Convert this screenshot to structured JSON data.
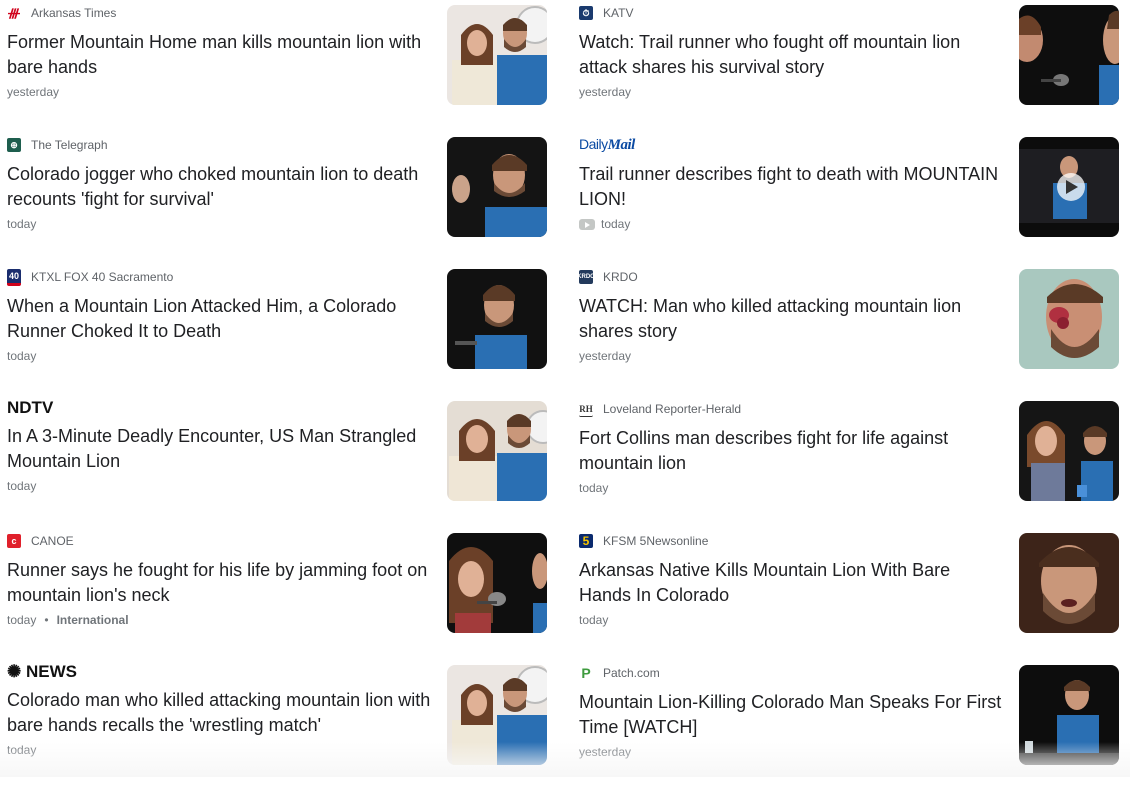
{
  "articles": [
    {
      "source": "Arkansas Times",
      "headline": "Former Mountain Home man kills mountain lion with bare hands",
      "time": "yesterday",
      "logo": "arkansas-times-logo",
      "thumb": "couple-photo-thumbnail"
    },
    {
      "source": "KATV",
      "headline": "Watch: Trail runner who fought off mountain lion attack shares his survival story",
      "time": "yesterday",
      "logo": "katv-logo",
      "thumb": "man-at-microphone-thumbnail"
    },
    {
      "source": "The Telegraph",
      "headline": "Colorado jogger who choked mountain lion to death recounts 'fight for survival'",
      "time": "today",
      "logo": "telegraph-logo",
      "thumb": "man-gesturing-thumbnail"
    },
    {
      "source": "Daily Mail",
      "headline": "Trail runner describes fight to death with MOUNTAIN LION!",
      "time": "today",
      "logo": "daily-mail-logo",
      "thumb": "video-press-conference-thumbnail",
      "video": true
    },
    {
      "source": "KTXL FOX 40 Sacramento",
      "headline": "When a Mountain Lion Attacked Him, a Colorado Runner Choked It to Death",
      "time": "today",
      "logo": "fox40-logo",
      "thumb": "man-speaking-thumbnail"
    },
    {
      "source": "KRDO",
      "headline": "WATCH: Man who killed attacking mountain lion shares story",
      "time": "yesterday",
      "logo": "krdo-logo",
      "thumb": "injured-face-thumbnail"
    },
    {
      "source": "NDTV",
      "headline": "In A 3-Minute Deadly Encounter, US Man Strangled Mountain Lion",
      "time": "today",
      "logo": "ndtv-logo",
      "thumb": "couple-photo-thumbnail"
    },
    {
      "source": "Loveland Reporter-Herald",
      "headline": "Fort Collins man describes fight for life against mountain lion",
      "time": "today",
      "logo": "reporter-herald-logo",
      "thumb": "press-conference-panel-thumbnail"
    },
    {
      "source": "CANOE",
      "headline": "Runner says he fought for his life by jamming foot on mountain lion's neck",
      "time": "today",
      "tag": "International",
      "logo": "canoe-logo",
      "thumb": "woman-at-microphone-thumbnail"
    },
    {
      "source": "KFSM 5Newsonline",
      "headline": "Arkansas Native Kills Mountain Lion With Bare Hands In Colorado",
      "time": "today",
      "logo": "kfsm-logo",
      "thumb": "man-closeup-thumbnail"
    },
    {
      "source": "NBC NEWS",
      "headline": "Colorado man who killed attacking mountain lion with bare hands recalls the 'wrestling match'",
      "time": "today",
      "logo": "nbc-news-logo",
      "thumb": "couple-photo-thumbnail"
    },
    {
      "source": "Patch.com",
      "headline": "Mountain Lion-Killing Colorado Man Speaks For First Time [WATCH]",
      "time": "yesterday",
      "logo": "patch-logo",
      "thumb": "man-at-podium-thumbnail"
    }
  ],
  "colors": {
    "headline": "#202124",
    "meta": "#70757a",
    "jacket": "#2a6fb3",
    "dark_bg": "#111111",
    "skin": "#c9977a",
    "hair": "#5a3a26"
  }
}
